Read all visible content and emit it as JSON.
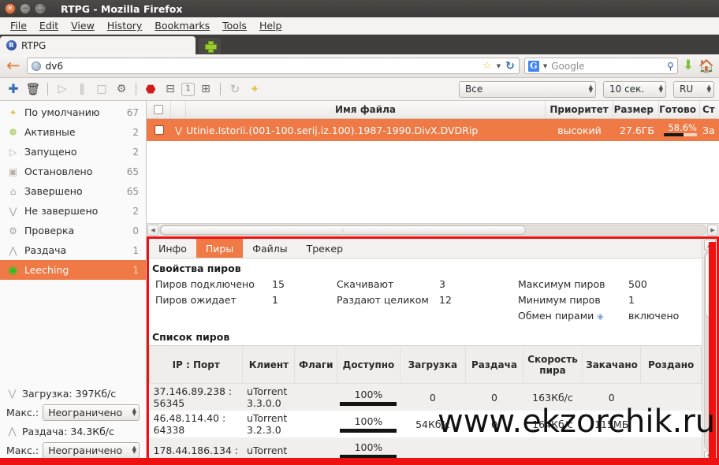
{
  "window": {
    "title": "RTPG - Mozilla Firefox",
    "buttons": {
      "close": "×",
      "minimize": "−",
      "maximize": "□"
    }
  },
  "menubar": {
    "items": [
      "File",
      "Edit",
      "View",
      "History",
      "Bookmarks",
      "Tools",
      "Help"
    ]
  },
  "browser_tab": {
    "favicon_letter": "R",
    "label": "RTPG",
    "newtab_label": "+"
  },
  "navbar": {
    "back_icon": "←",
    "url": "dv6",
    "star_icon": "☆",
    "reload_icon": "↻",
    "search_engine": "Google",
    "search_placeholder": "Google",
    "g_letter": "G",
    "magnifier_icon": "⚲",
    "download_icon": "⬇",
    "home_icon": "🏠"
  },
  "app_toolbar": {
    "icons": [
      {
        "name": "add-torrent-icon",
        "glyph": "✚"
      },
      {
        "name": "remove-torrent-icon",
        "glyph": "🗑"
      },
      {
        "name": "start-icon",
        "glyph": "▷"
      },
      {
        "name": "pause-icon",
        "glyph": "‖"
      },
      {
        "name": "stop-icon",
        "glyph": "□"
      },
      {
        "name": "settings-icon",
        "glyph": "⚙"
      },
      {
        "name": "record-stop-icon",
        "glyph": "⬣"
      },
      {
        "name": "priority-low-icon",
        "glyph": "⊟"
      },
      {
        "name": "priority-normal-icon",
        "glyph": "1"
      },
      {
        "name": "priority-high-icon",
        "glyph": "⊞"
      },
      {
        "name": "refresh-icon",
        "glyph": "↻"
      },
      {
        "name": "star-icon",
        "glyph": "✦"
      }
    ],
    "filter_select": "Все",
    "interval_select": "10 сек.",
    "lang_select": "RU"
  },
  "sidebar": {
    "items": [
      {
        "icon": "✦",
        "name": "default",
        "label": "По умолчанию",
        "count": "67",
        "active": false
      },
      {
        "icon": "❁",
        "name": "active",
        "label": "Активные",
        "count": "2",
        "active": false
      },
      {
        "icon": "▷",
        "name": "running",
        "label": "Запущено",
        "count": "2",
        "active": false
      },
      {
        "icon": "▣",
        "name": "stopped",
        "label": "Остановлено",
        "count": "65",
        "active": false
      },
      {
        "icon": "⌂",
        "name": "completed",
        "label": "Завершено",
        "count": "65",
        "active": false
      },
      {
        "icon": "⋁",
        "name": "incomplete",
        "label": "Не завершено",
        "count": "2",
        "active": false
      },
      {
        "icon": "⚙",
        "name": "checking",
        "label": "Проверка",
        "count": "0",
        "active": false
      },
      {
        "icon": "⋀",
        "name": "seeding",
        "label": "Раздача",
        "count": "1",
        "active": false
      },
      {
        "icon": "◉",
        "name": "leeching",
        "label": "Leeching",
        "count": "1",
        "active": true
      }
    ],
    "download": {
      "icon": "⋁",
      "label": "Загрузка: 397Кб/с",
      "max_label": "Макс.:",
      "max_value": "Неограничено"
    },
    "upload": {
      "icon": "⋀",
      "label": "Раздача: 34.3Кб/с",
      "max_label": "Макс.:",
      "max_value": "Неограничено"
    }
  },
  "torrent_list": {
    "headers": {
      "name": "Имя файла",
      "priority": "Приоритет",
      "size": "Размер",
      "done": "Готово",
      "status": "Ст"
    },
    "rows": [
      {
        "icon": "⋁",
        "name": "Utinie.Istorii.(001-100.serij.iz.100).1987-1990.DivX.DVDRip",
        "priority": "высокий",
        "size": "27.6ГБ",
        "done": "58.6%",
        "done_pct": 58.6,
        "status": "За"
      }
    ]
  },
  "details": {
    "tabs": [
      {
        "label": "Инфо",
        "name": "info",
        "active": false
      },
      {
        "label": "Пиры",
        "name": "peers",
        "active": true
      },
      {
        "label": "Файлы",
        "name": "files",
        "active": false
      },
      {
        "label": "Трекер",
        "name": "tracker",
        "active": false
      }
    ],
    "properties_title": "Свойства пиров",
    "properties": {
      "col1": [
        {
          "key": "Пиров подключено",
          "value": "15"
        },
        {
          "key": "Пиров ожидает",
          "value": "1"
        }
      ],
      "col2": [
        {
          "key": "Скачивают",
          "value": "3"
        },
        {
          "key": "Раздают целиком",
          "value": "12"
        }
      ],
      "col3": [
        {
          "key": "Максимум пиров",
          "value": "500"
        },
        {
          "key": "Минимум пиров",
          "value": "1"
        },
        {
          "key": "Обмен пирами",
          "value": "включено",
          "badge": "◈"
        }
      ]
    },
    "peers_title": "Список пиров",
    "peers_headers": [
      "IP : Порт",
      "Клиент",
      "Флаги",
      "Доступно",
      "Загрузка",
      "Раздача",
      "Скорость пира",
      "Закачано",
      "Роздано"
    ],
    "peers_rows": [
      {
        "ip": "37.146.89.238 : 56345",
        "client": "uTorrent 3.3.0.0",
        "flags": "",
        "available": "100%",
        "available_pct": 100,
        "download": "0",
        "upload": "0",
        "peer_speed": "163Кб/с",
        "downloaded": "0",
        "uploaded": ""
      },
      {
        "ip": "46.48.114.40 : 64338",
        "client": "uTorrent 3.2.3.0",
        "flags": "",
        "available": "100%",
        "available_pct": 100,
        "download": "54Кб/с",
        "upload": "0",
        "peer_speed": "164Кб/с",
        "downloaded": "115МБ",
        "uploaded": ""
      },
      {
        "ip": "178.44.186.134 :",
        "client": "uTorrent",
        "flags": "",
        "available": "100%",
        "available_pct": 100,
        "download": "",
        "upload": "",
        "peer_speed": "",
        "downloaded": "",
        "uploaded": ""
      }
    ]
  },
  "watermark": "www.ekzorchik.ru",
  "colors": {
    "accent_orange": "#ef7a45",
    "highlight_red": "#ee1111",
    "titlebar": "#3f3e3c"
  }
}
